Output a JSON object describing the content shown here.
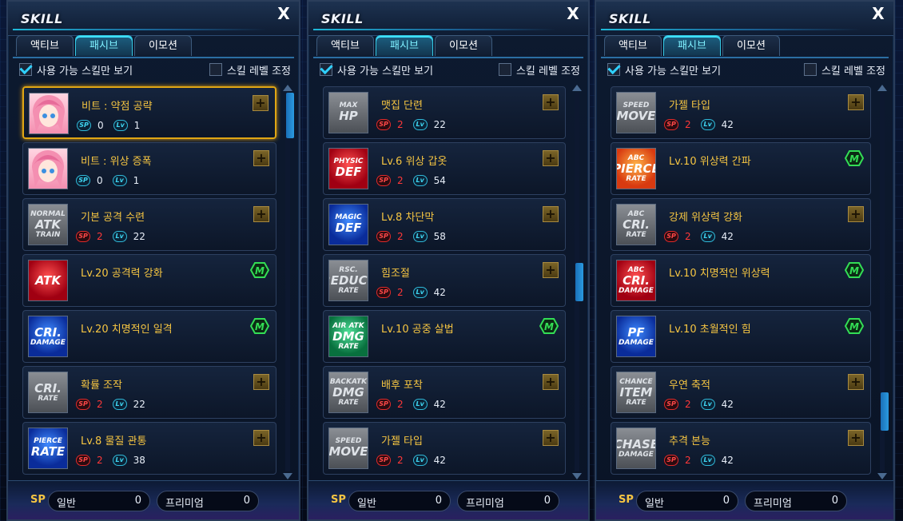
{
  "panels": [
    {
      "title": "SKILL",
      "tabs": [
        "액티브",
        "패시브",
        "이모션"
      ],
      "active_tab": 1,
      "options": {
        "available_only": "사용 가능 스킬만 보기",
        "available_checked": true,
        "level_adjust": "스킬 레벨 조정",
        "level_checked": false
      },
      "items": [
        {
          "name": "비트 : 약점 공략",
          "icon": {
            "top": "",
            "main": "",
            "bottom": "",
            "color": "char"
          },
          "sp": "0",
          "lv": "1",
          "action": "plus",
          "selected": true,
          "sp_red": false
        },
        {
          "name": "비트 : 위상 증폭",
          "icon": {
            "top": "",
            "main": "",
            "bottom": "",
            "color": "char"
          },
          "sp": "0",
          "lv": "1",
          "action": "plus",
          "selected": false,
          "sp_red": false
        },
        {
          "name": "기본 공격 수련",
          "icon": {
            "top": "NORMAL",
            "main": "ATK",
            "bottom": "TRAIN",
            "color": "gray"
          },
          "sp": "2",
          "lv": "22",
          "action": "plus",
          "selected": false,
          "sp_red": true
        },
        {
          "name": "Lv.20 공격력 강화",
          "icon": {
            "top": "",
            "main": "ATK",
            "bottom": "",
            "color": "red"
          },
          "sp": "",
          "lv": "",
          "action": "m",
          "selected": false,
          "sp_red": true
        },
        {
          "name": "Lv.20 치명적인 일격",
          "icon": {
            "top": "",
            "main": "CRI.",
            "bottom": "DAMAGE",
            "color": "blue"
          },
          "sp": "",
          "lv": "",
          "action": "m",
          "selected": false,
          "sp_red": true
        },
        {
          "name": "확률 조작",
          "icon": {
            "top": "",
            "main": "CRI.",
            "bottom": "RATE",
            "color": "gray"
          },
          "sp": "2",
          "lv": "22",
          "action": "plus",
          "selected": false,
          "sp_red": true
        },
        {
          "name": "Lv.8 물질 관통",
          "icon": {
            "top": "PIERCE",
            "main": "RATE",
            "bottom": "",
            "color": "blue"
          },
          "sp": "2",
          "lv": "38",
          "action": "plus",
          "selected": false,
          "sp_red": true
        }
      ],
      "scroll_thumb": {
        "top": 0,
        "size": 0.12
      },
      "footer": {
        "sp": "SP",
        "normal_label": "일반",
        "normal_value": "0",
        "premium_label": "프리미엄",
        "premium_value": "0"
      }
    },
    {
      "title": "SKILL",
      "tabs": [
        "액티브",
        "패시브",
        "이모션"
      ],
      "active_tab": 1,
      "options": {
        "available_only": "사용 가능 스킬만 보기",
        "available_checked": true,
        "level_adjust": "스킬 레벨 조정",
        "level_checked": false
      },
      "items": [
        {
          "name": "맷집 단련",
          "icon": {
            "top": "MAX",
            "main": "HP",
            "bottom": "",
            "color": "gray"
          },
          "sp": "2",
          "lv": "22",
          "action": "plus",
          "selected": false,
          "sp_red": true
        },
        {
          "name": "Lv.6 위상 갑옷",
          "icon": {
            "top": "PHYSIC",
            "main": "DEF",
            "bottom": "",
            "color": "red"
          },
          "sp": "2",
          "lv": "54",
          "action": "plus",
          "selected": false,
          "sp_red": true
        },
        {
          "name": "Lv.8 차단막",
          "icon": {
            "top": "MAGIC",
            "main": "DEF",
            "bottom": "",
            "color": "blue"
          },
          "sp": "2",
          "lv": "58",
          "action": "plus",
          "selected": false,
          "sp_red": true
        },
        {
          "name": "힘조절",
          "icon": {
            "top": "RSC.",
            "main": "REDUCE",
            "bottom": "RATE",
            "color": "gray"
          },
          "sp": "2",
          "lv": "42",
          "action": "plus",
          "selected": false,
          "sp_red": true
        },
        {
          "name": "Lv.10 공중 살법",
          "icon": {
            "top": "AIR ATK",
            "main": "DMG",
            "bottom": "RATE",
            "color": "green"
          },
          "sp": "",
          "lv": "",
          "action": "m",
          "selected": false,
          "sp_red": true
        },
        {
          "name": "배후 포착",
          "icon": {
            "top": "BACKATK",
            "main": "DMG",
            "bottom": "RATE",
            "color": "gray"
          },
          "sp": "2",
          "lv": "42",
          "action": "plus",
          "selected": false,
          "sp_red": true
        },
        {
          "name": "가젤 타입",
          "icon": {
            "top": "SPEED",
            "main": "MOVE",
            "bottom": "",
            "color": "gray"
          },
          "sp": "2",
          "lv": "42",
          "action": "plus",
          "selected": false,
          "sp_red": true
        }
      ],
      "scroll_thumb": {
        "top": 0.5,
        "size": 0.1
      },
      "footer": {
        "sp": "SP",
        "normal_label": "일반",
        "normal_value": "0",
        "premium_label": "프리미엄",
        "premium_value": "0"
      }
    },
    {
      "title": "SKILL",
      "tabs": [
        "액티브",
        "패시브",
        "이모션"
      ],
      "active_tab": 1,
      "options": {
        "available_only": "사용 가능 스킬만 보기",
        "available_checked": true,
        "level_adjust": "스킬 레벨 조정",
        "level_checked": false
      },
      "items": [
        {
          "name": "가젤 타입",
          "icon": {
            "top": "SPEED",
            "main": "MOVE",
            "bottom": "",
            "color": "gray"
          },
          "sp": "2",
          "lv": "42",
          "action": "plus",
          "selected": false,
          "sp_red": true
        },
        {
          "name": "Lv.10 위상력 간파",
          "icon": {
            "top": "ABC",
            "main": "PIERCE",
            "bottom": "RATE",
            "color": "orange"
          },
          "sp": "",
          "lv": "",
          "action": "m",
          "selected": false,
          "sp_red": true
        },
        {
          "name": "강제 위상력 강화",
          "icon": {
            "top": "ABC",
            "main": "CRI.",
            "bottom": "RATE",
            "color": "gray"
          },
          "sp": "2",
          "lv": "42",
          "action": "plus",
          "selected": false,
          "sp_red": true
        },
        {
          "name": "Lv.10 치명적인 위상력",
          "icon": {
            "top": "ABC",
            "main": "CRI.",
            "bottom": "DAMAGE",
            "color": "red"
          },
          "sp": "",
          "lv": "",
          "action": "m",
          "selected": false,
          "sp_red": true
        },
        {
          "name": "Lv.10 초월적인 힘",
          "icon": {
            "top": "",
            "main": "PF",
            "bottom": "DAMAGE",
            "color": "blue"
          },
          "sp": "",
          "lv": "",
          "action": "m",
          "selected": false,
          "sp_red": true
        },
        {
          "name": "우연 축적",
          "icon": {
            "top": "CHANCE",
            "main": "ITEM",
            "bottom": "RATE",
            "color": "gray"
          },
          "sp": "2",
          "lv": "42",
          "action": "plus",
          "selected": false,
          "sp_red": true
        },
        {
          "name": "추격 본능",
          "icon": {
            "top": "",
            "main": "CHASE",
            "bottom": "DAMAGE",
            "color": "gray"
          },
          "sp": "2",
          "lv": "42",
          "action": "plus",
          "selected": false,
          "sp_red": true
        }
      ],
      "scroll_thumb": {
        "top": 0.88,
        "size": 0.1
      },
      "footer": {
        "sp": "SP",
        "normal_label": "일반",
        "normal_value": "0",
        "premium_label": "프리미엄",
        "premium_value": "0"
      }
    }
  ],
  "labels": {
    "close": "X",
    "sp_badge": "SP",
    "lv_badge": "Lv",
    "plus": "+",
    "m": "M"
  },
  "colors": {
    "accent": "#2fd0ff",
    "gold": "#f5c542",
    "red": "#ff3838",
    "green": "#33dd55"
  }
}
